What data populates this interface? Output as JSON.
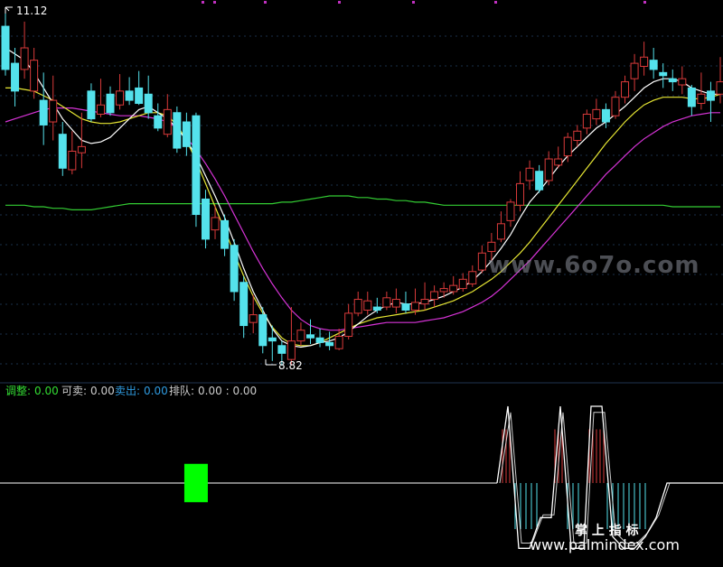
{
  "chart_data": {
    "type": "candlestick",
    "price_labels": {
      "high": "11.12",
      "low": "8.82"
    },
    "colors": {
      "background": "#000000",
      "up": "#d93a3a",
      "down": "#54e2ec",
      "ma_white": "#ffffff",
      "ma_yellow": "#e6e633",
      "ma_magenta": "#d633d6",
      "ma_green": "#33cc33",
      "grid": "#1a2f4a",
      "indicator_line": "#ffffff",
      "indicator_fill_up": "#d93a3a",
      "indicator_fill_down": "#54e2ec",
      "signal_block": "#00ff00"
    },
    "candles": [
      [
        11.02,
        10.74,
        11.12,
        10.7
      ],
      [
        10.78,
        10.6,
        10.88,
        10.5
      ],
      [
        10.74,
        10.88,
        11.05,
        10.68
      ],
      [
        10.6,
        10.8,
        10.88,
        10.55
      ],
      [
        10.54,
        10.38,
        10.72,
        10.25
      ],
      [
        10.4,
        10.54,
        10.7,
        10.28
      ],
      [
        10.32,
        10.1,
        10.4,
        10.05
      ],
      [
        10.09,
        10.21,
        10.34,
        10.06
      ],
      [
        10.2,
        10.24,
        10.46,
        10.1
      ],
      [
        10.6,
        10.42,
        10.65,
        10.4
      ],
      [
        10.45,
        10.51,
        10.68,
        10.43
      ],
      [
        10.58,
        10.46,
        10.63,
        10.44
      ],
      [
        10.51,
        10.6,
        10.71,
        10.48
      ],
      [
        10.6,
        10.54,
        10.69,
        10.51
      ],
      [
        10.62,
        10.52,
        10.73,
        10.51
      ],
      [
        10.58,
        10.46,
        10.7,
        10.42
      ],
      [
        10.44,
        10.36,
        10.52,
        10.34
      ],
      [
        10.32,
        10.48,
        10.58,
        10.3
      ],
      [
        10.46,
        10.23,
        10.5,
        10.2
      ],
      [
        10.4,
        10.24,
        10.46,
        10.18
      ],
      [
        10.44,
        9.8,
        10.46,
        9.72
      ],
      [
        9.9,
        9.64,
        9.96,
        9.58
      ],
      [
        9.7,
        9.78,
        9.86,
        9.64
      ],
      [
        9.76,
        9.58,
        9.8,
        9.53
      ],
      [
        9.6,
        9.3,
        9.64,
        9.24
      ],
      [
        9.36,
        9.08,
        9.4,
        9.0
      ],
      [
        9.1,
        9.15,
        9.28,
        9.03
      ],
      [
        9.15,
        8.95,
        9.2,
        8.9
      ],
      [
        9.0,
        8.98,
        9.08,
        8.85
      ],
      [
        8.95,
        8.9,
        8.98,
        8.82
      ],
      [
        8.86,
        8.98,
        9.2,
        8.82
      ],
      [
        8.98,
        9.05,
        9.1,
        8.95
      ],
      [
        9.02,
        9.0,
        9.12,
        8.96
      ],
      [
        9.0,
        8.97,
        9.06,
        8.94
      ],
      [
        8.97,
        8.95,
        9.04,
        8.92
      ],
      [
        8.93,
        9.01,
        9.06,
        8.92
      ],
      [
        9.01,
        9.16,
        9.22,
        8.99
      ],
      [
        9.16,
        9.25,
        9.3,
        9.14
      ],
      [
        9.18,
        9.24,
        9.3,
        9.15
      ],
      [
        9.2,
        9.18,
        9.26,
        9.16
      ],
      [
        9.2,
        9.26,
        9.3,
        9.18
      ],
      [
        9.2,
        9.25,
        9.32,
        9.16
      ],
      [
        9.22,
        9.18,
        9.3,
        9.16
      ],
      [
        9.18,
        9.23,
        9.32,
        9.15
      ],
      [
        9.22,
        9.25,
        9.36,
        9.18
      ],
      [
        9.25,
        9.3,
        9.34,
        9.2
      ],
      [
        9.3,
        9.32,
        9.36,
        9.26
      ],
      [
        9.3,
        9.34,
        9.4,
        9.28
      ],
      [
        9.32,
        9.38,
        9.42,
        9.3
      ],
      [
        9.35,
        9.43,
        9.47,
        9.33
      ],
      [
        9.44,
        9.55,
        9.6,
        9.42
      ],
      [
        9.56,
        9.62,
        9.68,
        9.5
      ],
      [
        9.64,
        9.74,
        9.82,
        9.62
      ],
      [
        9.76,
        9.88,
        9.9,
        9.72
      ],
      [
        9.86,
        10.0,
        10.08,
        9.82
      ],
      [
        10.02,
        10.1,
        10.15,
        9.96
      ],
      [
        10.08,
        9.96,
        10.12,
        9.94
      ],
      [
        10.02,
        10.16,
        10.21,
        9.99
      ],
      [
        10.12,
        10.16,
        10.24,
        10.1
      ],
      [
        10.18,
        10.3,
        10.33,
        10.14
      ],
      [
        10.28,
        10.34,
        10.38,
        10.24
      ],
      [
        10.36,
        10.45,
        10.48,
        10.32
      ],
      [
        10.42,
        10.48,
        10.55,
        10.38
      ],
      [
        10.48,
        10.4,
        10.52,
        10.36
      ],
      [
        10.44,
        10.56,
        10.6,
        10.42
      ],
      [
        10.56,
        10.66,
        10.7,
        10.52
      ],
      [
        10.68,
        10.78,
        10.84,
        10.6
      ],
      [
        10.76,
        10.82,
        10.92,
        10.7
      ],
      [
        10.8,
        10.74,
        10.88,
        10.68
      ],
      [
        10.72,
        10.7,
        10.78,
        10.62
      ],
      [
        10.68,
        10.66,
        10.74,
        10.6
      ],
      [
        10.64,
        10.68,
        10.76,
        10.58
      ],
      [
        10.62,
        10.5,
        10.64,
        10.44
      ],
      [
        10.52,
        10.58,
        10.72,
        10.48
      ],
      [
        10.6,
        10.54,
        10.66,
        10.4
      ],
      [
        10.58,
        10.66,
        10.82,
        10.52
      ]
    ],
    "ma_white": [
      10.88,
      10.84,
      10.8,
      10.72,
      10.62,
      10.52,
      10.42,
      10.35,
      10.28,
      10.26,
      10.27,
      10.3,
      10.36,
      10.42,
      10.48,
      10.5,
      10.46,
      10.42,
      10.36,
      10.28,
      10.18,
      10.05,
      9.92,
      9.78,
      9.62,
      9.45,
      9.3,
      9.18,
      9.06,
      8.98,
      8.95,
      8.94,
      8.95,
      8.97,
      8.98,
      9.0,
      9.04,
      9.09,
      9.14,
      9.18,
      9.21,
      9.23,
      9.22,
      9.22,
      9.23,
      9.25,
      9.27,
      9.3,
      9.33,
      9.37,
      9.43,
      9.5,
      9.58,
      9.67,
      9.78,
      9.88,
      9.95,
      10.03,
      10.11,
      10.18,
      10.24,
      10.3,
      10.36,
      10.4,
      10.45,
      10.5,
      10.56,
      10.62,
      10.66,
      10.68,
      10.68,
      10.66,
      10.62,
      10.6,
      10.58,
      10.58
    ],
    "ma_yellow": [
      10.62,
      10.62,
      10.61,
      10.6,
      10.57,
      10.54,
      10.5,
      10.46,
      10.42,
      10.4,
      10.39,
      10.39,
      10.4,
      10.42,
      10.44,
      10.46,
      10.46,
      10.44,
      10.38,
      10.28,
      10.15,
      10.0,
      9.85,
      9.7,
      9.55,
      9.4,
      9.27,
      9.16,
      9.07,
      9.0,
      8.96,
      8.95,
      8.95,
      8.97,
      9.0,
      9.03,
      9.06,
      9.09,
      9.11,
      9.13,
      9.14,
      9.15,
      9.16,
      9.17,
      9.18,
      9.2,
      9.22,
      9.24,
      9.27,
      9.3,
      9.34,
      9.38,
      9.43,
      9.49,
      9.55,
      9.62,
      9.7,
      9.78,
      9.86,
      9.94,
      10.02,
      10.1,
      10.18,
      10.26,
      10.33,
      10.4,
      10.46,
      10.51,
      10.54,
      10.56,
      10.56,
      10.56,
      10.55,
      10.55,
      10.56,
      10.58
    ],
    "ma_magenta": [
      10.4,
      10.42,
      10.44,
      10.46,
      10.48,
      10.49,
      10.49,
      10.49,
      10.48,
      10.47,
      10.46,
      10.45,
      10.44,
      10.44,
      10.44,
      10.43,
      10.42,
      10.4,
      10.36,
      10.3,
      10.22,
      10.13,
      10.03,
      9.92,
      9.8,
      9.68,
      9.56,
      9.45,
      9.35,
      9.26,
      9.18,
      9.12,
      9.08,
      9.06,
      9.05,
      9.05,
      9.06,
      9.07,
      9.08,
      9.09,
      9.1,
      9.1,
      9.1,
      9.1,
      9.11,
      9.12,
      9.13,
      9.15,
      9.17,
      9.2,
      9.23,
      9.27,
      9.32,
      9.38,
      9.44,
      9.5,
      9.57,
      9.64,
      9.71,
      9.78,
      9.85,
      9.92,
      9.99,
      10.06,
      10.12,
      10.18,
      10.24,
      10.29,
      10.33,
      10.37,
      10.4,
      10.42,
      10.44,
      10.45,
      10.46,
      10.46
    ],
    "ma_green": [
      9.86,
      9.86,
      9.86,
      9.85,
      9.85,
      9.84,
      9.84,
      9.83,
      9.83,
      9.83,
      9.84,
      9.85,
      9.86,
      9.87,
      9.87,
      9.87,
      9.87,
      9.87,
      9.87,
      9.87,
      9.87,
      9.87,
      9.87,
      9.87,
      9.87,
      9.87,
      9.87,
      9.87,
      9.87,
      9.88,
      9.88,
      9.89,
      9.9,
      9.91,
      9.92,
      9.92,
      9.92,
      9.91,
      9.91,
      9.9,
      9.9,
      9.89,
      9.89,
      9.88,
      9.88,
      9.87,
      9.86,
      9.86,
      9.86,
      9.86,
      9.86,
      9.86,
      9.86,
      9.86,
      9.86,
      9.86,
      9.86,
      9.86,
      9.86,
      9.86,
      9.86,
      9.86,
      9.86,
      9.86,
      9.86,
      9.86,
      9.86,
      9.86,
      9.86,
      9.86,
      9.85,
      9.85,
      9.85,
      9.85,
      9.85,
      9.85
    ],
    "indicator": {
      "legend": [
        {
          "label": "调整:",
          "value": "0.00",
          "color": "#33dd33"
        },
        {
          "label": "可卖:",
          "value": "0.00",
          "color": "#cccccc"
        },
        {
          "label": "卖出:",
          "value": "0.00",
          "color": "#2f9be0"
        },
        {
          "label": "排队:",
          "value": "0.00 : 0.00",
          "color": "#cccccc"
        }
      ],
      "baseline": 0,
      "signal_block": {
        "bar": 20,
        "high": 0.25,
        "low": -0.25
      },
      "line": [
        0,
        0,
        0,
        0,
        0,
        0,
        0,
        0,
        0,
        0,
        0,
        0,
        0,
        0,
        0,
        0,
        0,
        0,
        0,
        0,
        0,
        0,
        0,
        0,
        0,
        0,
        0,
        0,
        0,
        0,
        0,
        0,
        0,
        0,
        0,
        0,
        0,
        0,
        0,
        0,
        0,
        0,
        0,
        0,
        0,
        0,
        0,
        0,
        0,
        0,
        0,
        0,
        0,
        0,
        0,
        0,
        0,
        0,
        0,
        0,
        0,
        0,
        0,
        0,
        0,
        0,
        0,
        0,
        0,
        0,
        0,
        0,
        0,
        0,
        0,
        0
      ],
      "wave": [
        [
          550,
          0
        ],
        [
          562,
          1.0
        ],
        [
          574,
          -0.85
        ],
        [
          586,
          -0.85
        ],
        [
          598,
          -0.45
        ],
        [
          610,
          -0.45
        ],
        [
          620,
          1.0
        ],
        [
          632,
          -0.85
        ],
        [
          646,
          -0.85
        ],
        [
          654,
          1.0
        ],
        [
          666,
          1.0
        ],
        [
          678,
          -0.7
        ],
        [
          690,
          -0.85
        ],
        [
          702,
          -0.85
        ],
        [
          714,
          -0.7
        ],
        [
          726,
          -0.45
        ],
        [
          738,
          0
        ],
        [
          800,
          0
        ]
      ],
      "wave_bars_up": [
        556,
        560,
        564,
        614,
        618,
        622,
        652,
        656,
        660,
        664,
        668
      ],
      "wave_bars_down": [
        570,
        576,
        582,
        588,
        594,
        628,
        634,
        640,
        672,
        678,
        684,
        690,
        696,
        702,
        708,
        714
      ]
    }
  },
  "watermark_top": "www.6o7o.com",
  "watermark_bottom_cn": "掌 上 指 标",
  "watermark_bottom_url": "www.palmindex.com"
}
